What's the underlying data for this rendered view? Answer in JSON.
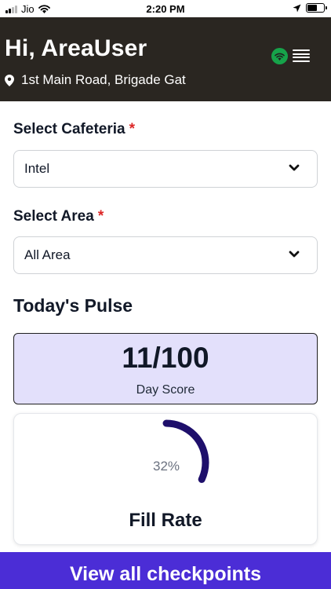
{
  "status_bar": {
    "carrier": "Jio",
    "time": "2:20 PM"
  },
  "header": {
    "greeting": "Hi, AreaUser",
    "address": "1st Main Road, Brigade Gat",
    "status_color": "#16a34a"
  },
  "form": {
    "cafeteria": {
      "label": "Select Cafeteria",
      "required_mark": "*",
      "value": "Intel"
    },
    "area": {
      "label": "Select Area",
      "required_mark": "*",
      "value": "All Area"
    }
  },
  "pulse": {
    "title": "Today's Pulse",
    "day_score": {
      "value": "11/100",
      "label": "Day Score"
    },
    "fill_rate": {
      "percent": 32,
      "percent_text": "32%",
      "label": "Fill Rate",
      "color": "#1e0f6b"
    }
  },
  "cta": {
    "label": "View all checkpoints",
    "color": "#4b2dd6"
  },
  "icons": {
    "signal": "signal-bars-icon",
    "wifi": "wifi-icon",
    "location_arrow": "location-arrow-icon",
    "battery": "battery-icon",
    "pin": "map-pin-icon",
    "status": "wifi-status-icon",
    "menu": "hamburger-menu-icon",
    "caret": "chevron-down-icon"
  }
}
